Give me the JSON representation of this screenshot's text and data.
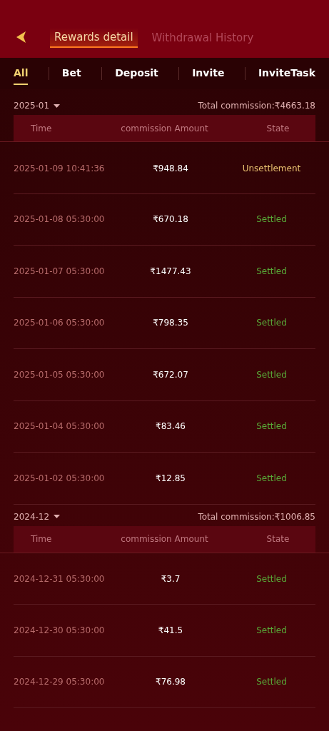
{
  "header": {
    "tabs": [
      {
        "label": "Rewards detail",
        "selected": true
      },
      {
        "label": "Withdrawal History",
        "selected": false
      }
    ]
  },
  "filters": [
    {
      "label": "All",
      "selected": true
    },
    {
      "label": "Bet",
      "selected": false
    },
    {
      "label": "Deposit",
      "selected": false
    },
    {
      "label": "Invite",
      "selected": false
    },
    {
      "label": "InviteTask",
      "selected": false
    }
  ],
  "sections": [
    {
      "month": "2025-01",
      "total": "Total commission:₹4663.18",
      "columns": [
        "Time",
        "commission Amount",
        "State"
      ],
      "rows": [
        {
          "time": "2025-01-09 10:41:36",
          "amount": "₹948.84",
          "state": "Unsettlement",
          "settled": false
        },
        {
          "time": "2025-01-08 05:30:00",
          "amount": "₹670.18",
          "state": "Settled",
          "settled": true
        },
        {
          "time": "2025-01-07 05:30:00",
          "amount": "₹1477.43",
          "state": "Settled",
          "settled": true
        },
        {
          "time": "2025-01-06 05:30:00",
          "amount": "₹798.35",
          "state": "Settled",
          "settled": true
        },
        {
          "time": "2025-01-05 05:30:00",
          "amount": "₹672.07",
          "state": "Settled",
          "settled": true
        },
        {
          "time": "2025-01-04 05:30:00",
          "amount": "₹83.46",
          "state": "Settled",
          "settled": true
        },
        {
          "time": "2025-01-02 05:30:00",
          "amount": "₹12.85",
          "state": "Settled",
          "settled": true
        }
      ]
    },
    {
      "month": "2024-12",
      "total": "Total commission:₹1006.85",
      "columns": [
        "Time",
        "commission Amount",
        "State"
      ],
      "rows": [
        {
          "time": "2024-12-31 05:30:00",
          "amount": "₹3.7",
          "state": "Settled",
          "settled": true
        },
        {
          "time": "2024-12-30 05:30:00",
          "amount": "₹41.5",
          "state": "Settled",
          "settled": true
        },
        {
          "time": "2024-12-29 05:30:00",
          "amount": "₹76.98",
          "state": "Settled",
          "settled": true
        }
      ]
    }
  ]
}
